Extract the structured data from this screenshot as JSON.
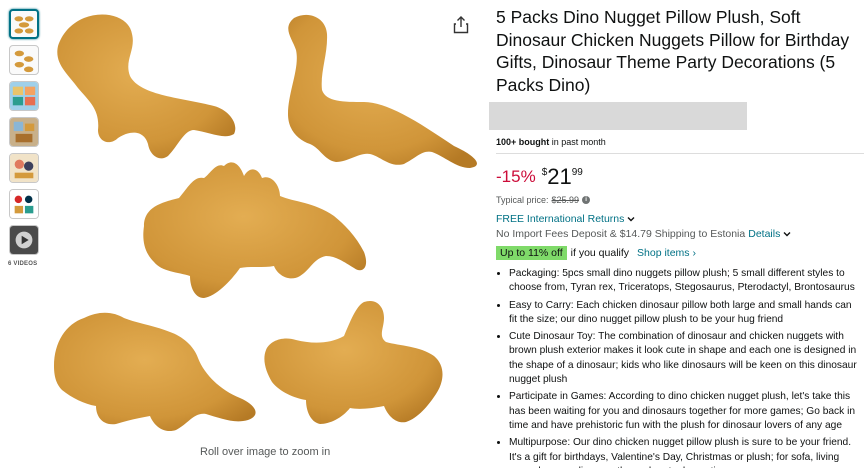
{
  "thumbnails": {
    "items": [
      {
        "name": "thumb-1"
      },
      {
        "name": "thumb-2"
      },
      {
        "name": "thumb-3"
      },
      {
        "name": "thumb-4"
      },
      {
        "name": "thumb-5"
      },
      {
        "name": "thumb-6"
      },
      {
        "name": "thumb-video"
      }
    ],
    "videos_label": "6 VIDEOS"
  },
  "main_image": {
    "zoom_hint": "Roll over image to zoom in",
    "share_icon": "share-icon"
  },
  "product": {
    "title": "5 Packs Dino Nugget Pillow Plush, Soft Dinosaur Chicken Nuggets Pillow for Birthday Gifts, Dinosaur Theme Party Decorations (5 Packs Dino)",
    "bought_bold": "100+ bought",
    "bought_rest": " in past month",
    "discount": "-15%",
    "currency_symbol": "$",
    "price_whole": "21",
    "price_fraction": "99",
    "typical_label": "Typical price:",
    "typical_price": "$25.99",
    "shipping_link": "FREE International Returns",
    "import_text": "No Import Fees Deposit & $14.79 Shipping to Estonia",
    "details_link": "Details",
    "deal_badge": "Up to 11% off",
    "deal_qualify": "if you qualify",
    "shop_items": "Shop items ›",
    "bullets": [
      "Packaging: 5pcs small dino nuggets pillow plush; 5 small different styles to choose from, Tyran rex, Triceratops, Stegosaurus, Pterodactyl, Brontosaurus",
      "Easy to Carry: Each chicken dinosaur pillow both large and small hands can fit the size; our dino nugget pillow plush to be your hug friend",
      "Cute Dinosaur Toy: The combination of dinosaur and chicken nuggets with brown plush exterior makes it look cute in shape and each one is designed in the shape of a dinosaur; kids who like dinosaurs will be keen on this dinosaur nugget plush",
      "Participate in Games: According to dino chicken nugget plush, let's take this has been waiting for you and dinosaurs together for more games; Go back in time and have prehistoric fun with the plush for dinosaur lovers of any age",
      "Multipurpose: Our dino chicken nugget pillow plush is sure to be your friend. It's a gift for birthdays, Valentine's Day, Christmas or plush; for sofa, living room decor or dinosaur themed party decorations"
    ]
  },
  "colors": {
    "nugget": "#d49a3c",
    "nugget_dark": "#b97a23",
    "link": "#007185",
    "discount": "#cc0c39",
    "deal": "#7fda69"
  }
}
